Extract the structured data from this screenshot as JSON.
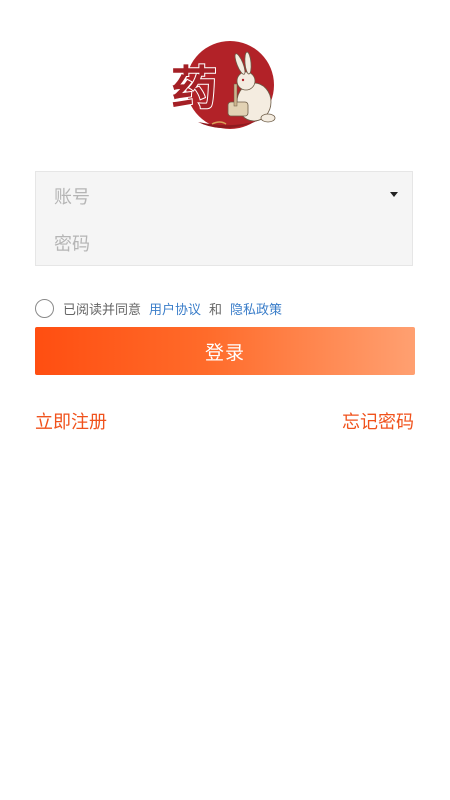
{
  "logo": {
    "glyph": "药",
    "colors": {
      "seal": "#b22228",
      "glyph": "#a41f25",
      "rabbit": "#f4ece0"
    }
  },
  "form": {
    "account_placeholder": "账号",
    "password_placeholder": "密码"
  },
  "agreement": {
    "prefix": "已阅读并同意",
    "user_agreement": "用户协议",
    "conjunction": "和",
    "privacy_policy": "隐私政策"
  },
  "login": {
    "label": "登录",
    "gradient": [
      "#ff4e11",
      "#ffa071"
    ]
  },
  "links": {
    "register": "立即注册",
    "forgot_password": "忘记密码"
  },
  "colors": {
    "accent": "#f0521c",
    "link": "#3a7dc9"
  }
}
